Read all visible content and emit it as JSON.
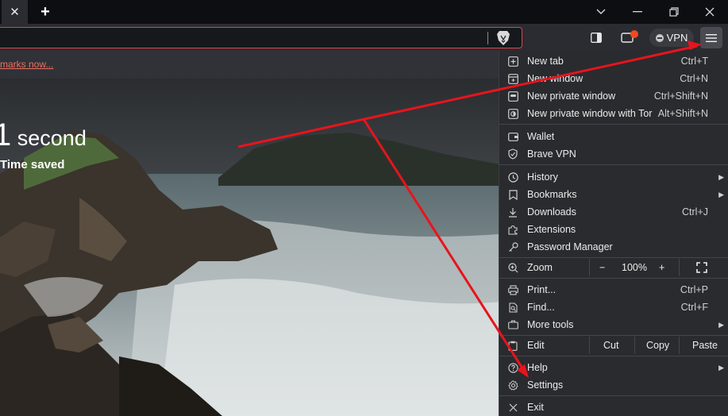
{
  "tabstrip": {
    "close_glyph": "✕",
    "new_tab_glyph": "+",
    "window_controls": {
      "chevron": "⌄",
      "minimize": "—",
      "restore": "❐",
      "close": "✕"
    }
  },
  "toolbar": {
    "vpn_label": "VPN"
  },
  "infobar": {
    "link_text": "marks now..."
  },
  "ntp": {
    "stat_number": "1",
    "stat_unit": "second",
    "stat_label": "Time saved"
  },
  "menu": {
    "new_tab": {
      "label": "New tab",
      "shortcut": "Ctrl+T"
    },
    "new_window": {
      "label": "New window",
      "shortcut": "Ctrl+N"
    },
    "new_private_window": {
      "label": "New private window",
      "shortcut": "Ctrl+Shift+N"
    },
    "new_private_window_tor": {
      "label": "New private window with Tor",
      "shortcut": "Alt+Shift+N"
    },
    "wallet": {
      "label": "Wallet"
    },
    "brave_vpn": {
      "label": "Brave VPN"
    },
    "history": {
      "label": "History"
    },
    "bookmarks": {
      "label": "Bookmarks"
    },
    "downloads": {
      "label": "Downloads",
      "shortcut": "Ctrl+J"
    },
    "extensions": {
      "label": "Extensions"
    },
    "password_manager": {
      "label": "Password Manager"
    },
    "zoom": {
      "label": "Zoom",
      "minus": "−",
      "value": "100%",
      "plus": "+"
    },
    "print": {
      "label": "Print...",
      "shortcut": "Ctrl+P"
    },
    "find": {
      "label": "Find...",
      "shortcut": "Ctrl+F"
    },
    "more_tools": {
      "label": "More tools"
    },
    "edit": {
      "label": "Edit",
      "cut": "Cut",
      "copy": "Copy",
      "paste": "Paste"
    },
    "help": {
      "label": "Help"
    },
    "settings": {
      "label": "Settings"
    },
    "exit": {
      "label": "Exit"
    }
  },
  "colors": {
    "accent_red": "#e8141c",
    "link_orange": "#f26f5c",
    "menu_bg": "#2a2b2f"
  }
}
